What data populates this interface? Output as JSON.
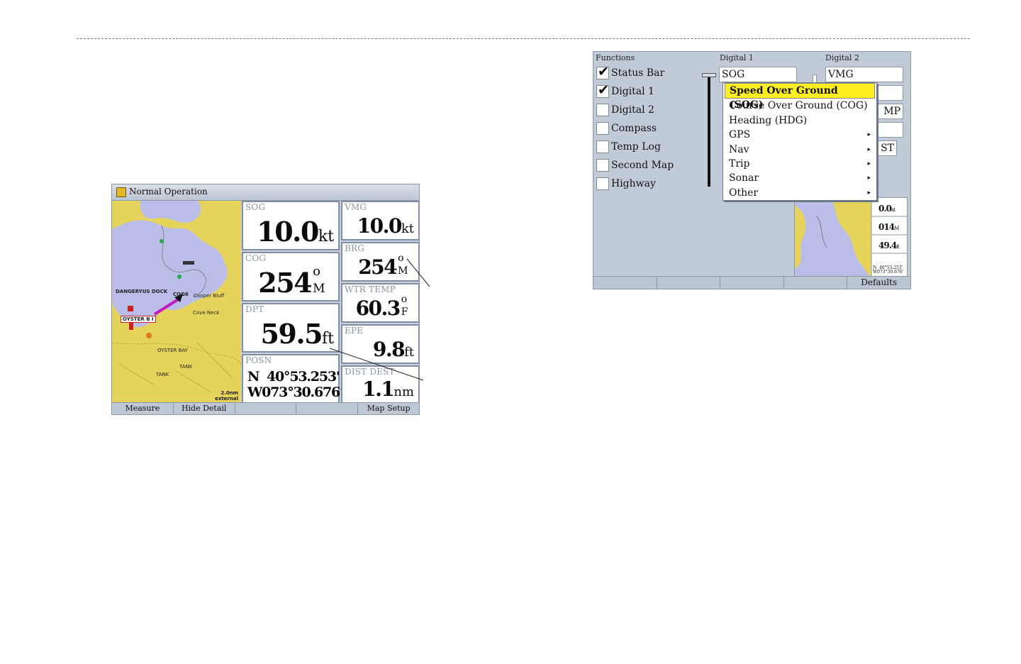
{
  "screen1": {
    "title": "Normal Operation",
    "map_labels": {
      "dangerous_dock": "DANGERYUS DOCK",
      "cog_tag": "COG6",
      "oyster_b": "OYSTER B I",
      "oyster_bay": "OYSTER BAY",
      "cooper_bluff": "Cooper Bluff",
      "cove_neck": "Cove Neck",
      "tank1": "TANK",
      "tank2": "TANK",
      "scale": "2.0nm",
      "scale_mode": "external"
    },
    "fields": {
      "sog": {
        "label": "SOG",
        "value": "10.0",
        "unit": "kt"
      },
      "cog": {
        "label": "COG",
        "value": "254",
        "deg": "o",
        "unit": "M"
      },
      "dpt": {
        "label": "DPT",
        "value": "59.5",
        "unit": "ft"
      },
      "posn": {
        "label": "POSN",
        "lat": "N  40°53.253'",
        "lon": "W073°30.676'"
      },
      "vmg": {
        "label": "VMG",
        "value": "10.0",
        "unit": "kt"
      },
      "brg": {
        "label": "BRG",
        "value": "254",
        "deg": "o",
        "unit": "M"
      },
      "wtr_temp": {
        "label": "WTR TEMP",
        "value": "60.3",
        "deg": "o",
        "unit": "F"
      },
      "epe": {
        "label": "EPE",
        "value": "9.8",
        "unit": "ft"
      },
      "dist_dest": {
        "label": "DIST DEST",
        "value": "1.1",
        "unit": "nm"
      }
    },
    "softkeys": [
      "Measure",
      "Hide Detail",
      "",
      "",
      "Map Setup"
    ]
  },
  "screen2": {
    "headers": {
      "functions": "Functions",
      "digital1": "Digital 1",
      "digital2": "Digital 2"
    },
    "functions": [
      {
        "label": "Status Bar",
        "checked": true
      },
      {
        "label": "Digital 1",
        "checked": true
      },
      {
        "label": "Digital 2",
        "checked": false
      },
      {
        "label": "Compass",
        "checked": false
      },
      {
        "label": "Temp Log",
        "checked": false
      },
      {
        "label": "Second Map",
        "checked": false
      },
      {
        "label": "Highway",
        "checked": false
      }
    ],
    "digital1_value": "SOG",
    "digital2_values": [
      "VMG",
      "",
      "MP",
      "",
      "ST"
    ],
    "dropdown": [
      {
        "label": "Speed Over Ground (SOG)",
        "submenu": false,
        "selected": true
      },
      {
        "label": "Course Over Ground (COG)",
        "submenu": false,
        "selected": false
      },
      {
        "label": "Heading (HDG)",
        "submenu": false,
        "selected": false
      },
      {
        "label": "GPS",
        "submenu": true,
        "selected": false
      },
      {
        "label": "Nav",
        "submenu": true,
        "selected": false
      },
      {
        "label": "Trip",
        "submenu": true,
        "selected": false
      },
      {
        "label": "Sonar",
        "submenu": true,
        "selected": false
      },
      {
        "label": "Other",
        "submenu": true,
        "selected": false
      }
    ],
    "submenu_arrow": "▸",
    "checkmark": "✔",
    "preview": {
      "v1": "0.0",
      "u1": "kt",
      "v2": "014",
      "u2": "M",
      "v3": "49.4",
      "u3": "ft",
      "lat": "N  40°53.253'",
      "lon": "W073°30.676'"
    },
    "softkeys": [
      "",
      "",
      "",
      "",
      "Defaults"
    ]
  },
  "colors": {
    "map_land": "#e6d35c",
    "map_water": "#b9bde8",
    "selection": "#ffee22",
    "screen_bg": "#c1cbd8"
  }
}
